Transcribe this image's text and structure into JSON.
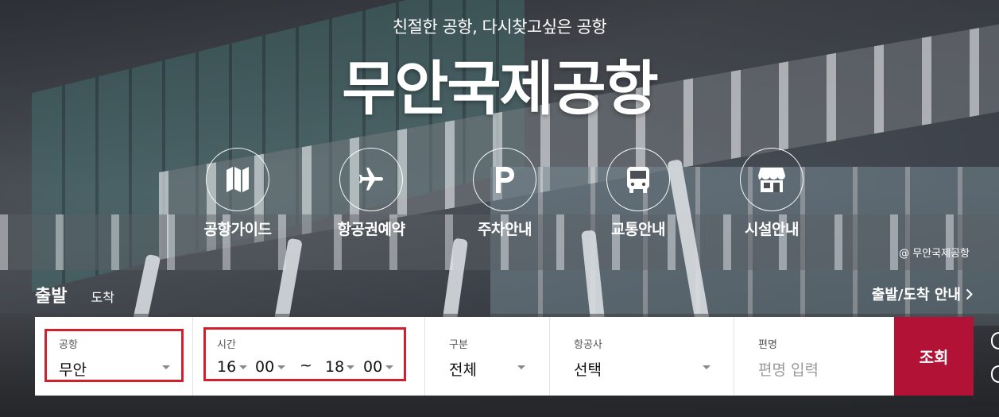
{
  "hero": {
    "subtitle": "친절한 공항, 다시찾고싶은 공항",
    "title": "무안국제공항"
  },
  "quick_menu": [
    {
      "label": "공항가이드",
      "icon": "map-icon"
    },
    {
      "label": "항공권예약",
      "icon": "airplane-icon"
    },
    {
      "label": "주차안내",
      "icon": "parking-icon"
    },
    {
      "label": "교통안내",
      "icon": "bus-icon"
    },
    {
      "label": "시설안내",
      "icon": "store-icon"
    }
  ],
  "credit": "@ 무안국제공항",
  "tabs": {
    "departure": "출발",
    "arrival": "도착"
  },
  "info_link": "출발/도착 안내",
  "search": {
    "airport": {
      "label": "공항",
      "value": "무안"
    },
    "time": {
      "label": "시간",
      "from_hour": "16",
      "from_min": "00",
      "separator": "~",
      "to_hour": "18",
      "to_min": "00"
    },
    "type": {
      "label": "구분",
      "value": "전체"
    },
    "airline": {
      "label": "항공사",
      "value": "선택"
    },
    "flight": {
      "label": "편명",
      "placeholder": "편명 입력"
    },
    "button": "조회"
  },
  "colors": {
    "accent": "#b31237",
    "highlight": "#d11f2e"
  }
}
